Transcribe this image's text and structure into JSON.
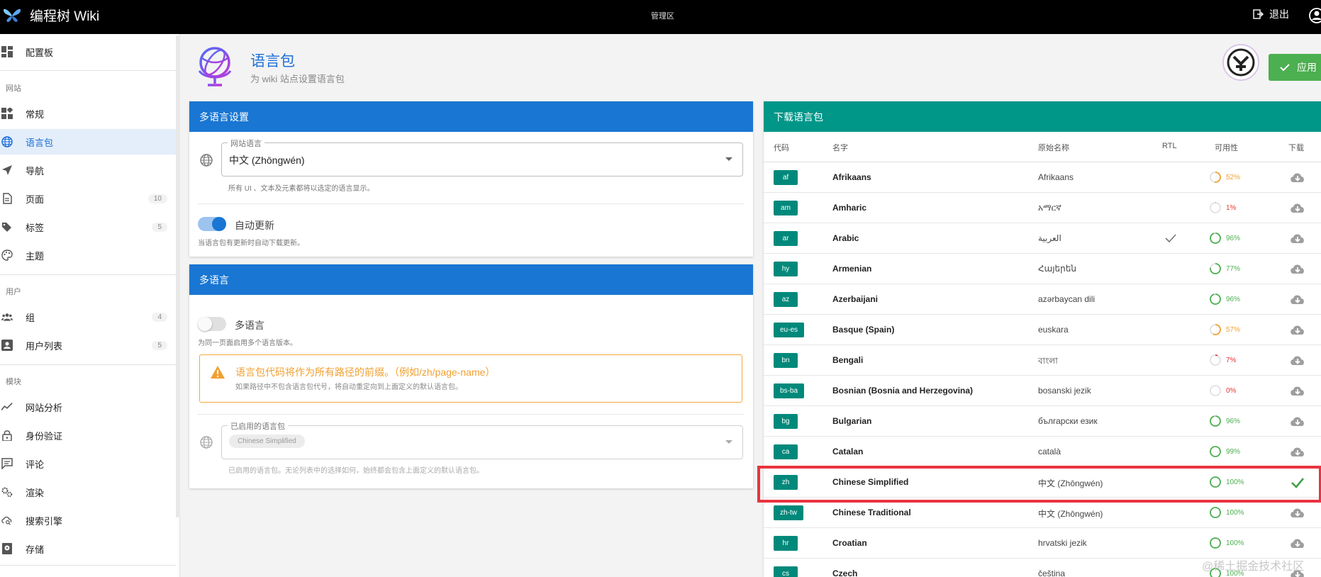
{
  "topbar": {
    "brand": "编程树 Wiki",
    "center_title": "管理区",
    "logout": "退出"
  },
  "sidebar": {
    "dashboard": "配置板",
    "section_site": "网站",
    "general": "常规",
    "locale": "语言包",
    "navigation": "导航",
    "pages": "页面",
    "pages_count": "10",
    "tags": "标签",
    "tags_count": "5",
    "theme": "主题",
    "section_users": "用户",
    "groups": "组",
    "groups_count": "4",
    "users": "用户列表",
    "users_count": "5",
    "section_modules": "模块",
    "analytics": "网站分析",
    "auth": "身份验证",
    "comments": "评论",
    "rendering": "渲染",
    "search": "搜索引擎",
    "storage": "存储"
  },
  "header": {
    "title": "语言包",
    "subtitle": "为 wiki 站点设置语言包",
    "apply": "应用"
  },
  "locale_settings": {
    "title": "多语言设置",
    "site_locale_label": "网站语言",
    "site_locale_value": "中文 (Zhōngwén)",
    "site_locale_hint": "所有 UI 、文本及元素都将以选定的语言显示。",
    "auto_update_label": "自动更新",
    "auto_update_on": true,
    "auto_update_hint": "当语言包有更新时自动下载更新。"
  },
  "multilingual": {
    "title": "多语言",
    "toggle_label": "多语言",
    "toggle_on": false,
    "toggle_hint": "为同一页面启用多个语言版本。",
    "alert_title": "语言包代码将作为所有路径的前缀。（例如/zh/page-name）",
    "alert_desc": "如果路径中不包含语言包代号，将自动重定向到上面定义的默认语言包。",
    "enabled_label": "已启用的语言包",
    "enabled_chip": "Chinese Simplified",
    "enabled_hint": "已启用的语言包。无论列表中的选择如何，始终都会包含上面定义的默认语言包。"
  },
  "download": {
    "title": "下载语言包",
    "columns": {
      "code": "代码",
      "name": "名字",
      "native": "原始名称",
      "rtl": "RTL",
      "availability": "可用性",
      "download": "下载"
    },
    "rows": [
      {
        "code": "af",
        "name": "Afrikaans",
        "native": "Afrikaans",
        "rtl": false,
        "availability": "52%",
        "pct": 52,
        "installed": false
      },
      {
        "code": "am",
        "name": "Amharic",
        "native": "አማርኛ",
        "rtl": false,
        "availability": "1%",
        "pct": 1,
        "installed": false
      },
      {
        "code": "ar",
        "name": "Arabic",
        "native": "العربية",
        "rtl": true,
        "availability": "96%",
        "pct": 96,
        "installed": false
      },
      {
        "code": "hy",
        "name": "Armenian",
        "native": "Հայերեն",
        "rtl": false,
        "availability": "77%",
        "pct": 77,
        "installed": false
      },
      {
        "code": "az",
        "name": "Azerbaijani",
        "native": "azərbaycan dili",
        "rtl": false,
        "availability": "96%",
        "pct": 96,
        "installed": false
      },
      {
        "code": "eu-es",
        "name": "Basque (Spain)",
        "native": "euskara",
        "rtl": false,
        "availability": "57%",
        "pct": 57,
        "installed": false
      },
      {
        "code": "bn",
        "name": "Bengali",
        "native": "বাংলা",
        "rtl": false,
        "availability": "7%",
        "pct": 7,
        "installed": false
      },
      {
        "code": "bs-ba",
        "name": "Bosnian (Bosnia and Herzegovina)",
        "native": "bosanski jezik",
        "rtl": false,
        "availability": "0%",
        "pct": 0,
        "installed": false
      },
      {
        "code": "bg",
        "name": "Bulgarian",
        "native": "български език",
        "rtl": false,
        "availability": "96%",
        "pct": 96,
        "installed": false
      },
      {
        "code": "ca",
        "name": "Catalan",
        "native": "català",
        "rtl": false,
        "availability": "99%",
        "pct": 99,
        "installed": false
      },
      {
        "code": "zh",
        "name": "Chinese Simplified",
        "native": "中文 (Zhōngwén)",
        "rtl": false,
        "availability": "100%",
        "pct": 100,
        "installed": true
      },
      {
        "code": "zh-tw",
        "name": "Chinese Traditional",
        "native": "中文 (Zhōngwén)",
        "rtl": false,
        "availability": "100%",
        "pct": 100,
        "installed": false
      },
      {
        "code": "hr",
        "name": "Croatian",
        "native": "hrvatski jezik",
        "rtl": false,
        "availability": "100%",
        "pct": 100,
        "installed": false
      },
      {
        "code": "cs",
        "name": "Czech",
        "native": "čeština",
        "rtl": false,
        "availability": "100%",
        "pct": 100,
        "installed": false
      }
    ]
  },
  "watermark": "@稀土掘金技术社区",
  "colors": {
    "primary": "#1976d2",
    "teal": "#009688",
    "success": "#4caf50",
    "warning": "#f0a030",
    "danger": "#e53935",
    "highlight": "#e8343f"
  }
}
